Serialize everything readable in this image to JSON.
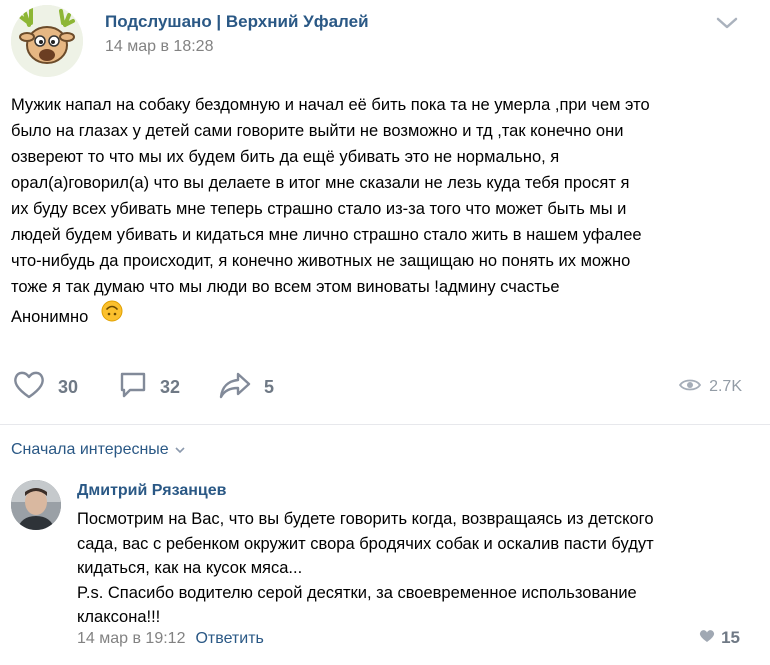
{
  "post": {
    "group_name": "Подслушано | Верхний Уфалей",
    "date": "14 мар в 18:28",
    "text_lines": [
      "Мужик напал на собаку бездомную и начал её бить пока та не умерла ,при чем это",
      "было на глазах у детей сами говорите выйти не возможно и тд ,так конечно они",
      "озвереют то что мы их будем бить да ещё убивать это не нормально, я",
      "орал(а)говорил(а) что вы делаете в итог мне сказали не лезь куда тебя просят я",
      "их буду всех убивать мне теперь страшно стало из-за того что может быть мы и",
      "людей будем убивать и кидаться мне лично страшно стало жить в нашем уфалее",
      "что-нибудь да происходит, я конечно животных не защищаю но понять их можно",
      "тоже я так думаю что мы люди во всем этом виноваты !админу счастье"
    ],
    "signature": "Анонимно",
    "likes": "30",
    "comments": "32",
    "shares": "5",
    "views": "2.7K"
  },
  "comments_section": {
    "sort_label": "Сначала интересные"
  },
  "comment": {
    "author": "Дмитрий Рязанцев",
    "text_lines": [
      "Посмотрим на Вас, что вы будете говорить когда, возвращаясь из детского",
      "сада, вас с ребенком окружит свора бродячих собак и оскалив пасти будут",
      "кидаться, как на кусок мяса...",
      "P.s. Спасибо водителю серой десятки, за своевременное использование",
      "клаксона!!!"
    ],
    "date": "14 мар в 19:12",
    "reply_label": "Ответить",
    "likes": "15"
  },
  "colors": {
    "link": "#2a5885",
    "meta": "#828282",
    "action": "#6f7985",
    "divider": "#e7e8ec"
  },
  "icons": [
    "group-avatar-deer",
    "chevron-down-icon",
    "heart-icon",
    "comment-icon",
    "share-icon",
    "eye-icon",
    "upside-down-face-emoji",
    "user-avatar",
    "small-heart-icon"
  ]
}
